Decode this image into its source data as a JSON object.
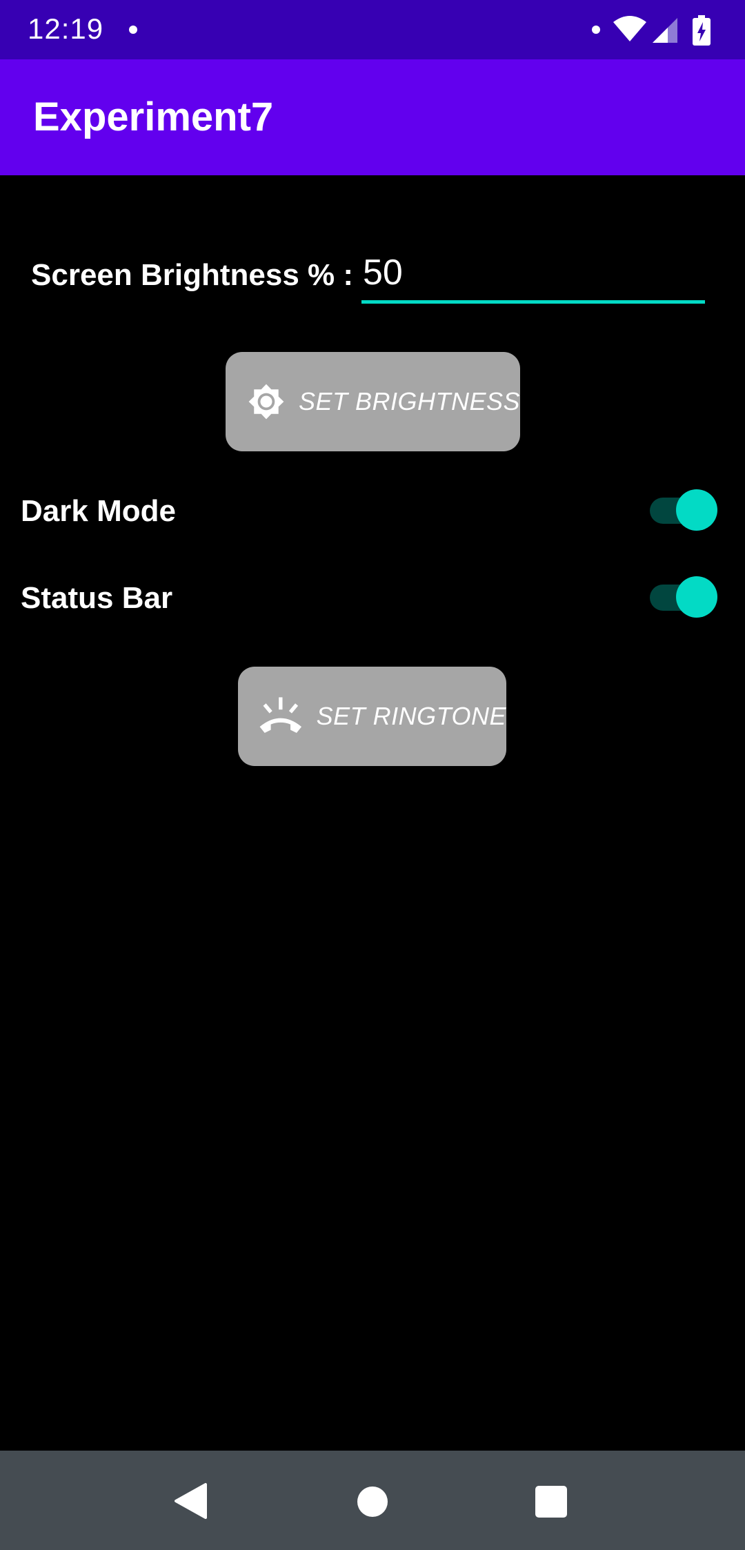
{
  "status_bar": {
    "time": "12:19",
    "icons": [
      "notification-dot-icon",
      "wifi-icon",
      "signal-icon",
      "battery-charging-icon"
    ]
  },
  "app_bar": {
    "title": "Experiment7"
  },
  "brightness": {
    "label": "Screen Brightness % :",
    "value": "50",
    "button_label": "SET BRIGHTNESS",
    "button_icon": "brightness-icon"
  },
  "toggles": [
    {
      "label": "Dark Mode",
      "checked": true
    },
    {
      "label": "Status Bar",
      "checked": true
    }
  ],
  "ringtone": {
    "button_label": "SET RINGTONE",
    "button_icon": "ringing-phone-icon"
  },
  "nav_bar": {
    "icons": [
      "back-icon",
      "home-icon",
      "recents-icon"
    ]
  },
  "colors": {
    "status_bar": "#3700b3",
    "app_bar": "#6200ee",
    "accent": "#03dac5",
    "switch_track": "#01463f",
    "button": "#a6a6a6",
    "background": "#000000",
    "nav_bar": "#454c52"
  }
}
